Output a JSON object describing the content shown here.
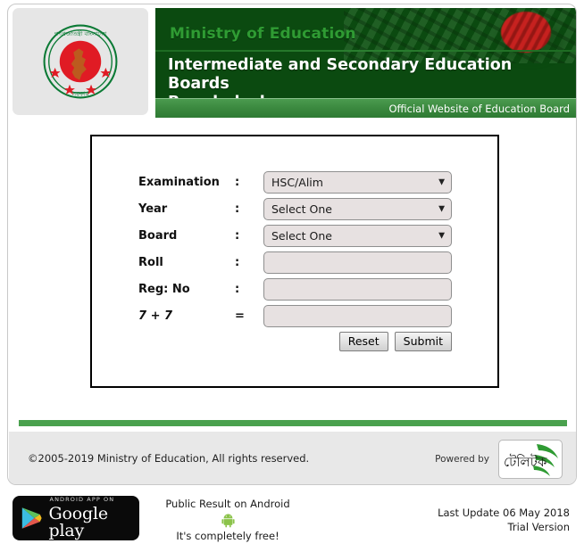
{
  "header": {
    "emblem_icon": "bangladesh-government-emblem",
    "ministry": "Ministry of Education",
    "board_title_line1": "Intermediate and Secondary Education Boards",
    "board_title_line2": "Bangladesh",
    "official_tagline": "Official Website of Education Board",
    "colors": {
      "banner_dark_green": "#0b4a10",
      "ministry_green": "#2f9b33",
      "tagline_band_green": "#3c8a40"
    }
  },
  "form": {
    "rows": [
      {
        "label": "Examination",
        "separator": ":",
        "type": "select",
        "value": "HSC/Alim"
      },
      {
        "label": "Year",
        "separator": ":",
        "type": "select",
        "value": "Select One"
      },
      {
        "label": "Board",
        "separator": ":",
        "type": "select",
        "value": "Select One"
      },
      {
        "label": "Roll",
        "separator": ":",
        "type": "input",
        "value": ""
      },
      {
        "label": "Reg: No",
        "separator": ":",
        "type": "input",
        "value": ""
      },
      {
        "label": "7 + 7",
        "separator": "=",
        "type": "input",
        "value": ""
      }
    ],
    "dropdown_arrow_icon": "chevron-down-icon",
    "reset_label": "Reset",
    "submit_label": "Submit"
  },
  "footer": {
    "copyright": "©2005-2019 Ministry of Education, All rights reserved.",
    "powered_by": "Powered by",
    "teletalk_logo_text": "টেলিটক",
    "teletalk_logo_icon": "teletalk-logo",
    "green_bar_color": "#4aa14e"
  },
  "bottom": {
    "gplay_small": "ANDROID APP ON",
    "gplay_big": "Google play",
    "gplay_icon": "google-play-icon",
    "android_line1": "Public Result on Android",
    "android_line2": "It's completely free!",
    "android_icon": "android-robot-icon",
    "last_update": "Last Update 06 May 2018",
    "trial": "Trial Version"
  }
}
